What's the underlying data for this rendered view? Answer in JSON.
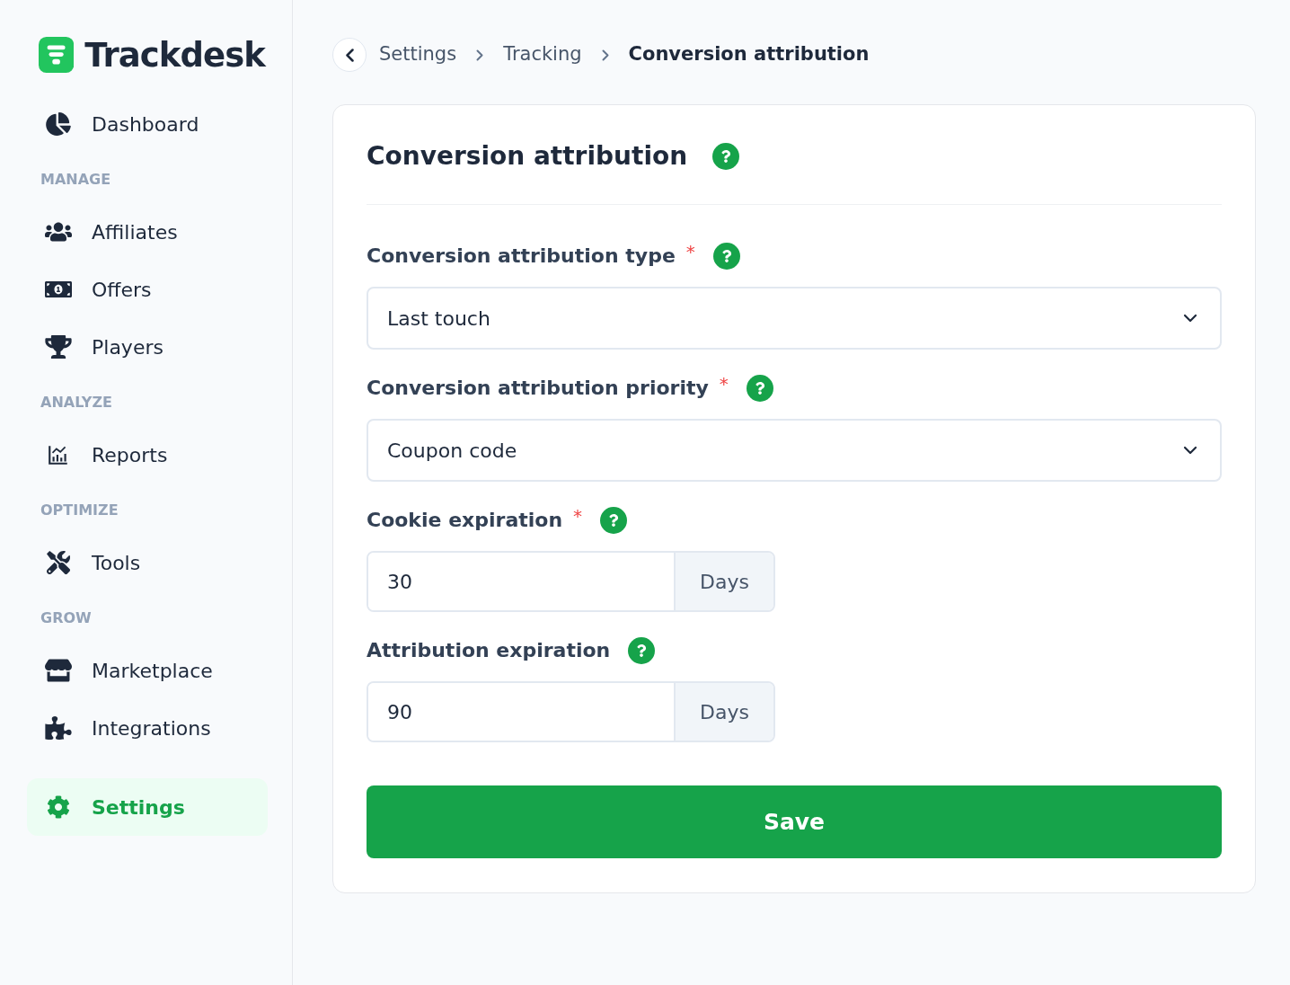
{
  "brand": {
    "name": "Trackdesk"
  },
  "sidebar": {
    "items": [
      {
        "kind": "item",
        "label": "Dashboard",
        "selected": false
      },
      {
        "kind": "section",
        "label": "MANAGE"
      },
      {
        "kind": "item",
        "label": "Affiliates",
        "selected": false
      },
      {
        "kind": "item",
        "label": "Offers",
        "selected": false
      },
      {
        "kind": "item",
        "label": "Players",
        "selected": false
      },
      {
        "kind": "section",
        "label": "ANALYZE"
      },
      {
        "kind": "item",
        "label": "Reports",
        "selected": false
      },
      {
        "kind": "section",
        "label": "OPTIMIZE"
      },
      {
        "kind": "item",
        "label": "Tools",
        "selected": false
      },
      {
        "kind": "section",
        "label": "GROW"
      },
      {
        "kind": "item",
        "label": "Marketplace",
        "selected": false
      },
      {
        "kind": "item",
        "label": "Integrations",
        "selected": false
      },
      {
        "kind": "item",
        "label": "Settings",
        "selected": true
      }
    ]
  },
  "breadcrumb": [
    {
      "label": "Settings",
      "current": false
    },
    {
      "label": "Tracking",
      "current": false
    },
    {
      "label": "Conversion attribution",
      "current": true
    }
  ],
  "card": {
    "title": "Conversion attribution",
    "fields": [
      {
        "kind": "select",
        "label": "Conversion attribution type",
        "required_mark": "*",
        "value": "Last touch"
      },
      {
        "kind": "select",
        "label": "Conversion attribution priority",
        "required_mark": "*",
        "value": "Coupon code"
      },
      {
        "kind": "number",
        "label": "Cookie expiration",
        "required_mark": "*",
        "value": "30",
        "unit": "Days"
      },
      {
        "kind": "number",
        "label": "Attribution expiration",
        "value": "90",
        "unit": "Days"
      }
    ],
    "save_button": "Save"
  }
}
